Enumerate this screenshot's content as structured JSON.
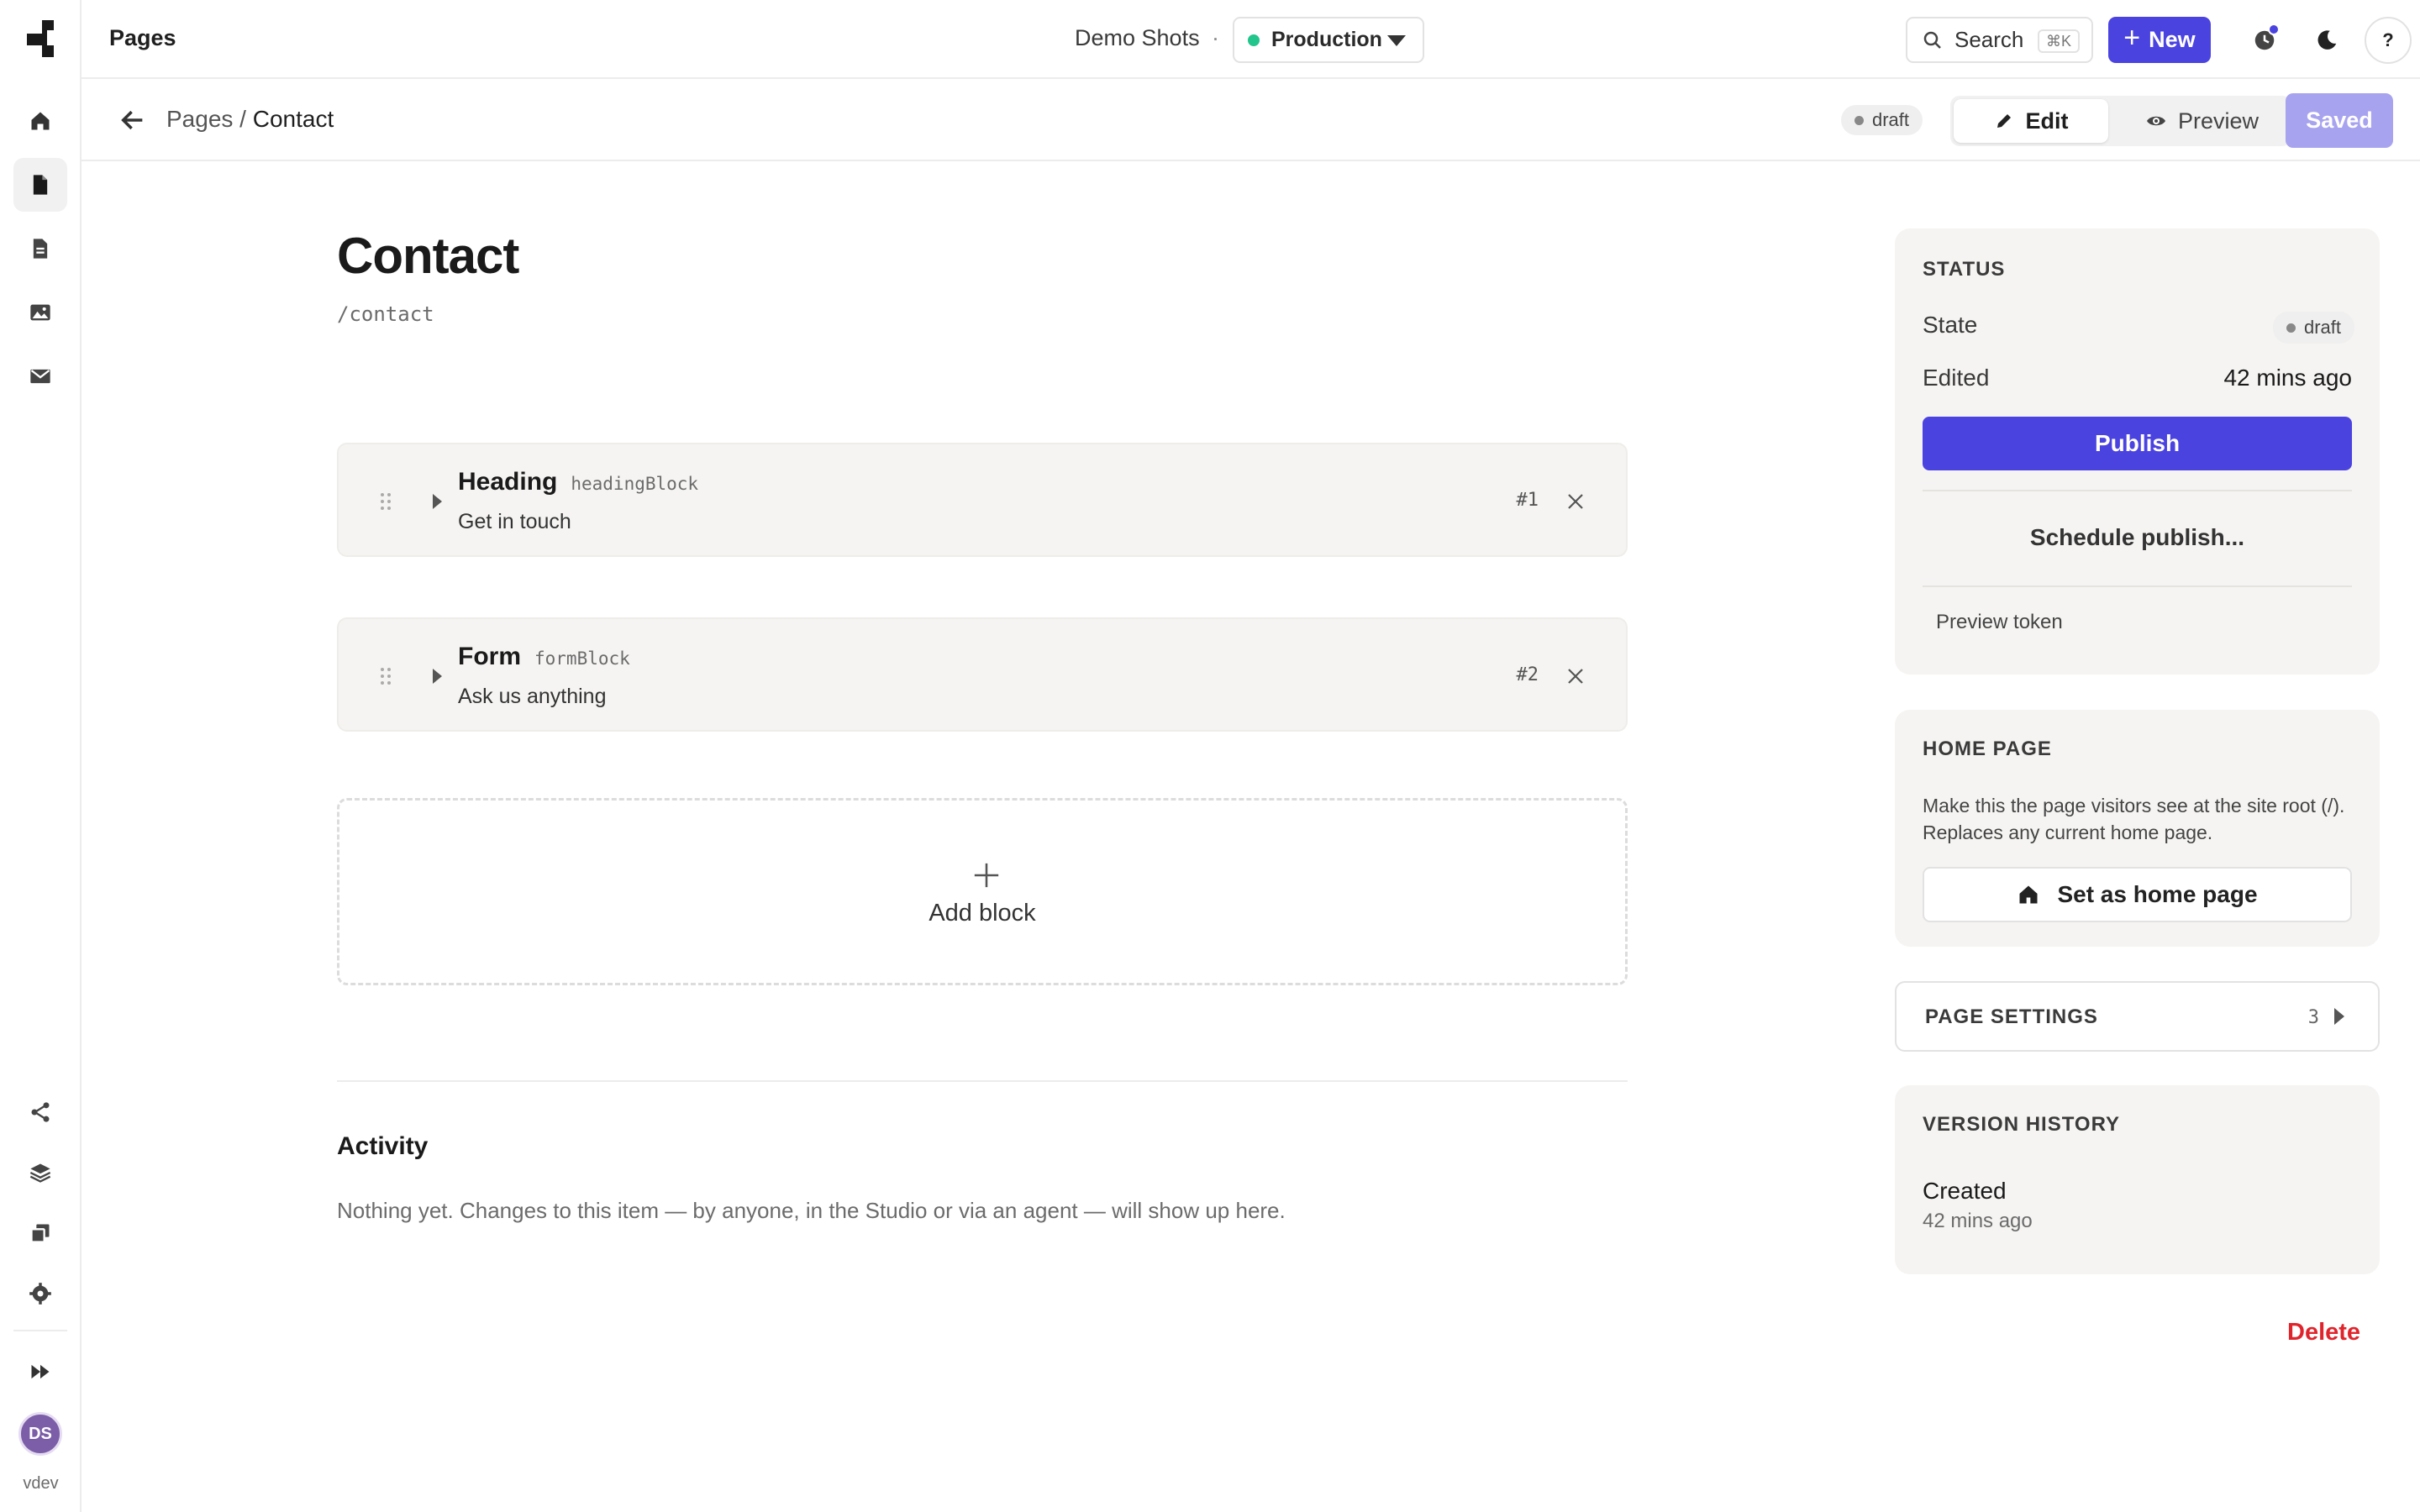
{
  "app": {
    "section_title": "Pages",
    "project_name": "Demo Shots",
    "project_sep": "·",
    "environment": "Production",
    "search_label": "Search",
    "search_shortcut": "⌘K",
    "new_label": "New",
    "help_label": "?",
    "user_initials": "DS",
    "user_name": "vdev",
    "accent_color": "#4b43e0",
    "env_status_color": "#22c58b",
    "danger_color": "#e0242c"
  },
  "sidebar": {
    "items": [
      {
        "name": "home-icon"
      },
      {
        "name": "pages-icon",
        "active": true
      },
      {
        "name": "document-icon"
      },
      {
        "name": "image-icon"
      },
      {
        "name": "mail-icon"
      }
    ],
    "bottom_items": [
      {
        "name": "share-icon"
      },
      {
        "name": "layers-icon"
      },
      {
        "name": "copy-icon"
      },
      {
        "name": "settings-icon"
      },
      {
        "name": "fast-forward-icon"
      }
    ]
  },
  "subheader": {
    "breadcrumb_root": "Pages",
    "breadcrumb_sep": " / ",
    "breadcrumb_current": "Contact",
    "status_badge": "draft",
    "edit_label": "Edit",
    "preview_label": "Preview",
    "saved_label": "Saved"
  },
  "page": {
    "title": "Contact",
    "slug": "/contact"
  },
  "blocks": [
    {
      "name": "Heading",
      "type": "headingBlock",
      "desc": "Get in touch",
      "num": "#1"
    },
    {
      "name": "Form",
      "type": "formBlock",
      "desc": "Ask us anything",
      "num": "#2"
    }
  ],
  "add_block_label": "Add block",
  "activity": {
    "title": "Activity",
    "empty_text": "Nothing yet. Changes to this item — by anyone, in the Studio or via an agent — will show up here."
  },
  "status_panel": {
    "title": "STATUS",
    "state_label": "State",
    "state_value": "draft",
    "edited_label": "Edited",
    "edited_value": "42 mins ago",
    "publish_label": "Publish",
    "schedule_label": "Schedule publish...",
    "preview_token_label": "Preview token"
  },
  "home_panel": {
    "title": "HOME PAGE",
    "description": "Make this the page visitors see at the site root (/). Replaces any current home page.",
    "button_label": "Set as home page"
  },
  "page_settings": {
    "title": "PAGE SETTINGS",
    "count": "3"
  },
  "version_history": {
    "title": "VERSION HISTORY",
    "entry_label": "Created",
    "entry_time": "42 mins ago"
  },
  "delete_label": "Delete"
}
